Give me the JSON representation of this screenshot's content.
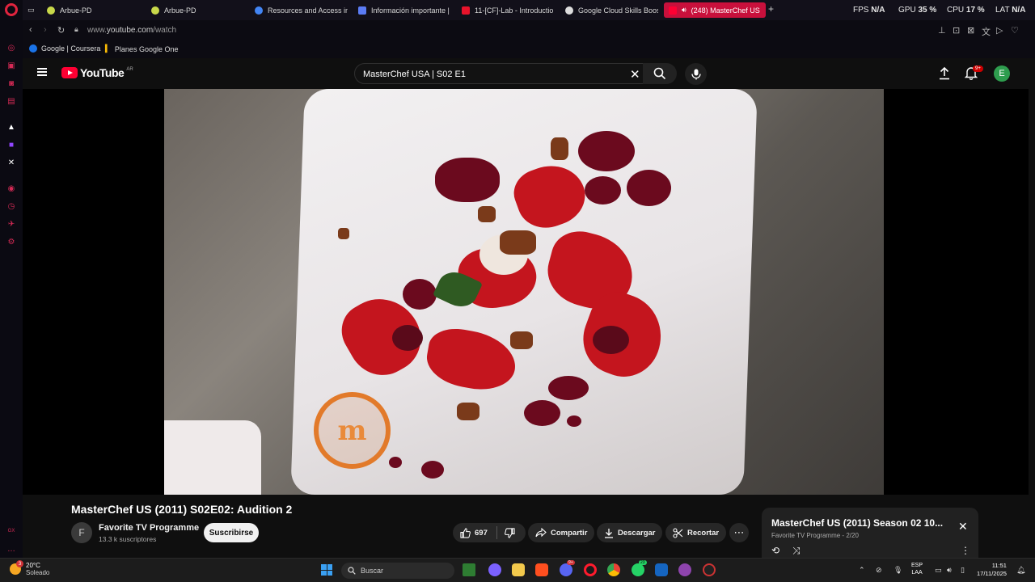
{
  "browser": {
    "tabs": [
      {
        "label": "Arbue-PD",
        "color": "#c8d84a"
      },
      {
        "label": "Arbue-PD",
        "color": "#c8d84a"
      },
      {
        "label": "Resources and Access in",
        "color": "#4285f4"
      },
      {
        "label": "Información importante |",
        "color": "#5b7cf5"
      },
      {
        "label": "11-[CF]-Lab - Introductio",
        "color": "#e8132b"
      },
      {
        "label": "Google Cloud Skills Boos",
        "color": "#dddddd"
      },
      {
        "label": "(248) MasterChef US",
        "color": "#ff0033"
      }
    ],
    "stats": {
      "fps_label": "FPS",
      "fps_value": "N/A",
      "gpu_label": "GPU",
      "gpu_value": "35 %",
      "cpu_label": "CPU",
      "cpu_value": "17 %",
      "lat_label": "LAT",
      "lat_value": "N/A"
    },
    "url_prefix": "www.",
    "url_host": "youtube.com",
    "url_path": "/watch",
    "bookmarks": [
      {
        "label": "Google | Coursera"
      },
      {
        "label": "Planes Google One"
      }
    ]
  },
  "youtube": {
    "logo_text": "YouTube",
    "country_code": "AR",
    "search_query": "MasterChef USA | S02 E1",
    "notification_badge": "9+",
    "avatar_letter": "E",
    "video": {
      "title": "MasterChef US (2011) S02E02: Audition 2",
      "channel_initial": "F",
      "channel_name": "Favorite TV Programme",
      "subscribers": "13.3 k suscriptores",
      "subscribe_label": "Suscribirse",
      "likes": "697",
      "share_label": "Compartir",
      "download_label": "Descargar",
      "clip_label": "Recortar",
      "watermark": "m"
    },
    "playlist": {
      "title": "MasterChef US (2011) Season 02 10...",
      "subtitle": "Favorite TV Programme - 2/20"
    }
  },
  "taskbar": {
    "temperature": "20°C",
    "condition": "Soleado",
    "weather_badge": "3",
    "search_placeholder": "Buscar",
    "lang_line1": "ESP",
    "lang_line2": "LAA",
    "time": "11:51",
    "date": "17/11/2025",
    "whatsapp_badge": "23",
    "discord_badge": "9+"
  },
  "colors": {
    "accent": "#c8103c",
    "youtube_red": "#ff0033",
    "opera_red": "#e0243e"
  }
}
